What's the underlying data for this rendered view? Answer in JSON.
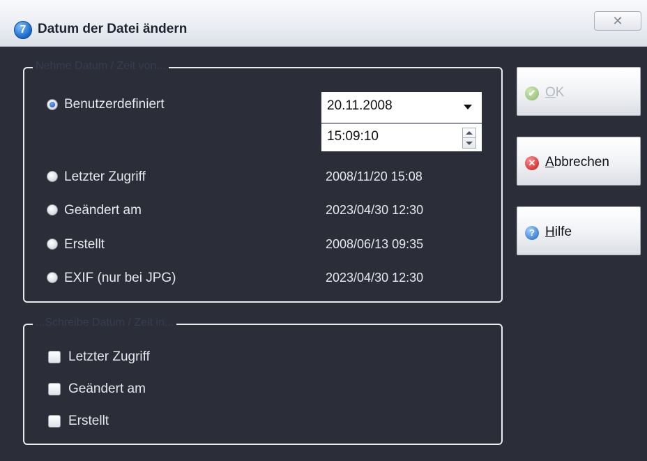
{
  "window": {
    "title": "Datum der Datei ändern",
    "icon": "7",
    "close_label": "✕"
  },
  "source_group": {
    "title": "Nehme Datum / Zeit von...",
    "custom_label": "Benutzerdefiniert",
    "custom_checked": true,
    "date_value": "20.11.2008",
    "time_value": "15:09:10",
    "options": [
      {
        "label": "Letzter Zugriff",
        "value": "2008/11/20 15:08"
      },
      {
        "label": "Geändert am",
        "value": "2023/04/30 12:30"
      },
      {
        "label": "Erstellt",
        "value": "2008/06/13 09:35"
      },
      {
        "label": "EXIF (nur bei JPG)",
        "value": "2023/04/30 12:30"
      }
    ]
  },
  "target_group": {
    "title": "...Schreibe Datum / Zeit in...",
    "checkboxes": [
      {
        "label": "Letzter Zugriff",
        "checked": false
      },
      {
        "label": "Geändert am",
        "checked": false
      },
      {
        "label": "Erstellt",
        "checked": false
      }
    ]
  },
  "buttons": {
    "ok_first": "O",
    "ok_rest": "K",
    "ok_enabled": false,
    "cancel_first": "A",
    "cancel_rest": "bbrechen",
    "help_first": "H",
    "help_rest": "ilfe"
  },
  "colors": {
    "background": "#2b2e38",
    "text": "#e6e8ee",
    "frame": "#e9ebef"
  }
}
